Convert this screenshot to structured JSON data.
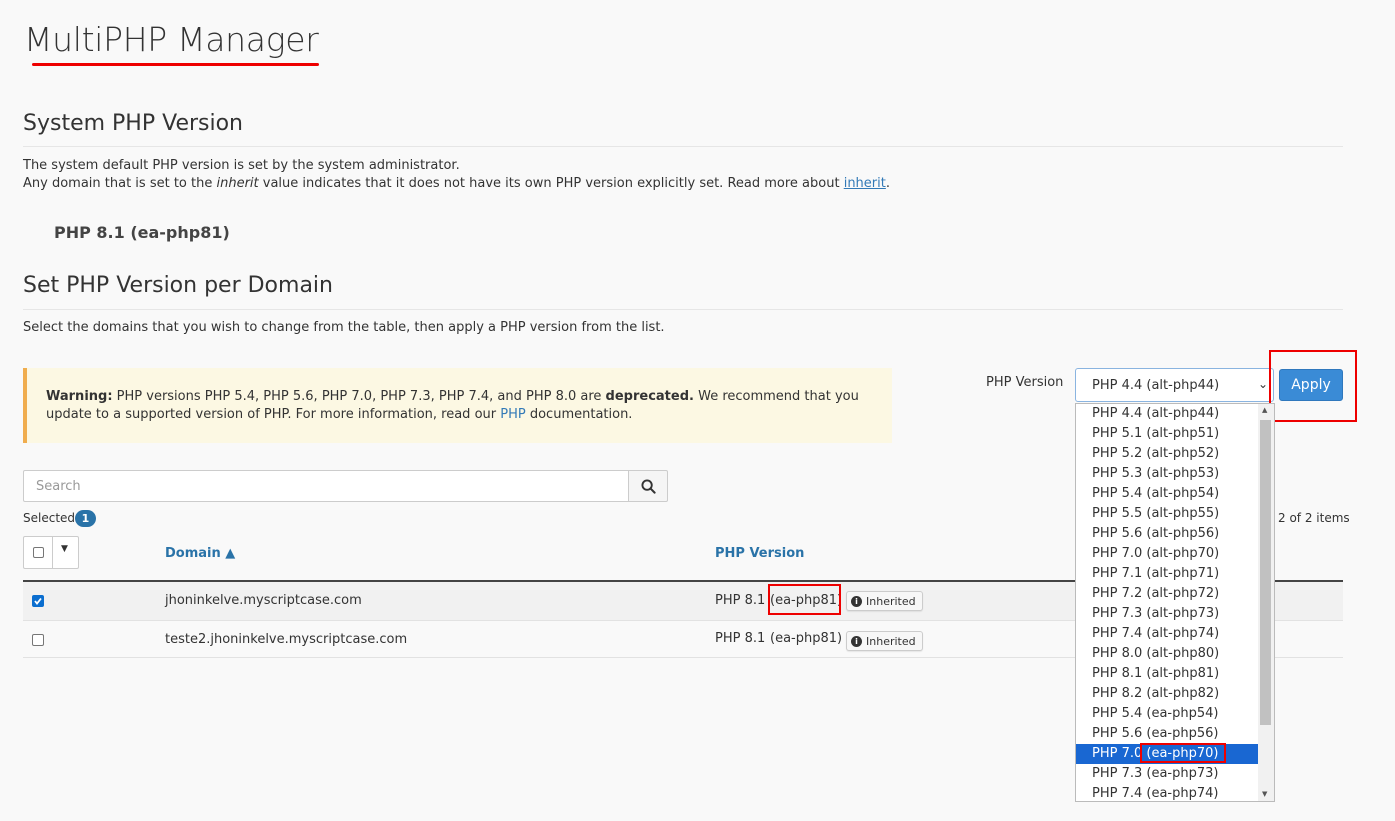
{
  "page": {
    "title": "MultiPHP Manager"
  },
  "system": {
    "heading": "System PHP Version",
    "line1": "The system default PHP version is set by the system administrator.",
    "line2_pre": "Any domain that is set to the ",
    "line2_em": "inherit",
    "line2_mid": " value indicates that it does not have its own PHP version explicitly set. Read more about ",
    "line2_link": "inherit",
    "line2_post": ".",
    "version": "PHP 8.1 (ea-php81)"
  },
  "per_domain": {
    "heading": "Set PHP Version per Domain",
    "description": "Select the domains that you wish to change from the table, then apply a PHP version from the list."
  },
  "warning": {
    "strong": "Warning:",
    "text1": " PHP versions PHP 5.4, PHP 5.6, PHP 7.0, PHP 7.3, PHP 7.4, and PHP 8.0 are ",
    "strong2": "deprecated.",
    "text2": " We recommend that you update to a supported version of PHP. For more information, read our ",
    "link": "PHP",
    "text3": " documentation."
  },
  "search": {
    "placeholder": "Search"
  },
  "selection": {
    "label": "Selected",
    "count": "1",
    "items_text": "2 of 2 items"
  },
  "table": {
    "headers": {
      "domain": "Domain ▲",
      "php_version": "PHP Version"
    },
    "rows": [
      {
        "domain": "jhoninkelve.myscriptcase.com",
        "php_prefix": "PHP 8.1 ",
        "php_code": "(ea-php81)",
        "badge": "Inherited",
        "checked": true
      },
      {
        "domain": "teste2.jhoninkelve.myscriptcase.com",
        "php_prefix": "PHP 8.1 ",
        "php_code": "(ea-php81)",
        "badge": "Inherited",
        "checked": false
      }
    ]
  },
  "php_select": {
    "label": "PHP Version",
    "selected": "PHP 4.4 (alt-php44)",
    "apply_label": "Apply",
    "options": [
      "PHP 4.4 (alt-php44)",
      "PHP 5.1 (alt-php51)",
      "PHP 5.2 (alt-php52)",
      "PHP 5.3 (alt-php53)",
      "PHP 5.4 (alt-php54)",
      "PHP 5.5 (alt-php55)",
      "PHP 5.6 (alt-php56)",
      "PHP 7.0 (alt-php70)",
      "PHP 7.1 (alt-php71)",
      "PHP 7.2 (alt-php72)",
      "PHP 7.3 (alt-php73)",
      "PHP 7.4 (alt-php74)",
      "PHP 8.0 (alt-php80)",
      "PHP 8.1 (alt-php81)",
      "PHP 8.2 (alt-php82)",
      "PHP 5.4 (ea-php54)",
      "PHP 5.6 (ea-php56)",
      "PHP 7.0 (ea-php70)",
      "PHP 7.3 (ea-php73)",
      "PHP 7.4 (ea-php74)"
    ],
    "highlighted_index": 17
  },
  "colors": {
    "accent": "#2a73a8",
    "annotation": "#ee0000",
    "highlight": "#1967d2"
  }
}
